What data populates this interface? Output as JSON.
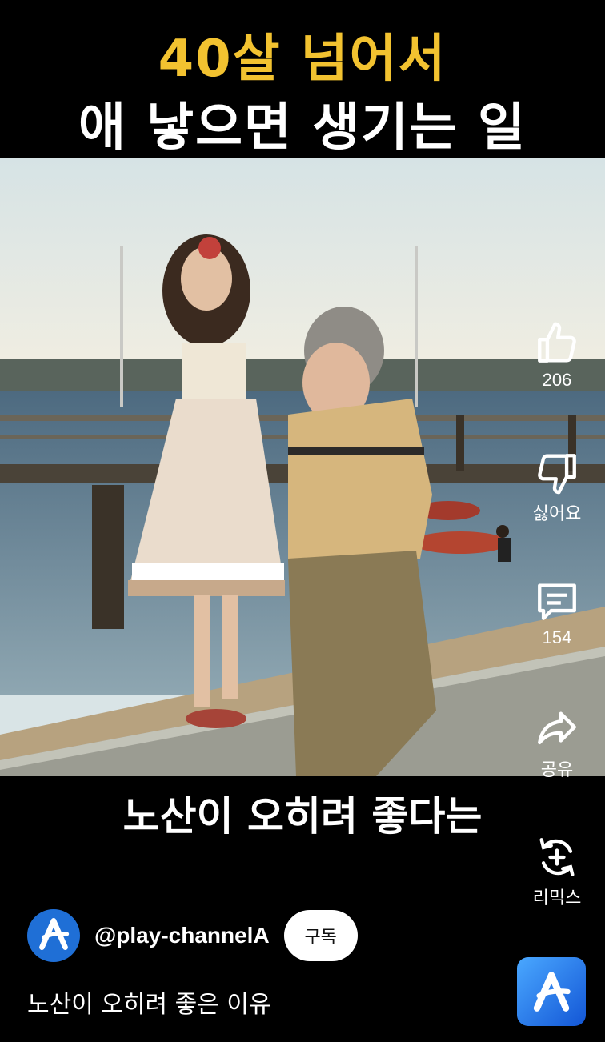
{
  "title": {
    "line1": "40살 넘어서",
    "line2": "애 낳으면 생기는 일",
    "line1_color": "#f2c230",
    "line2_color": "#ffffff"
  },
  "video": {
    "caption": "노산이 오히려 좋다는"
  },
  "actions": {
    "like_count": "206",
    "dislike_label": "싫어요",
    "comment_count": "154",
    "share_label": "공유",
    "remix_label": "리믹스"
  },
  "channel": {
    "handle": "@play-channelA",
    "subscribe_label": "구독",
    "avatar_color": "#1f6fd6"
  },
  "description": "노산이 오히려 좋은 이유",
  "icons": [
    "thumbs-up-icon",
    "thumbs-down-icon",
    "comment-icon",
    "share-icon",
    "remix-icon",
    "channel-logo-icon"
  ]
}
